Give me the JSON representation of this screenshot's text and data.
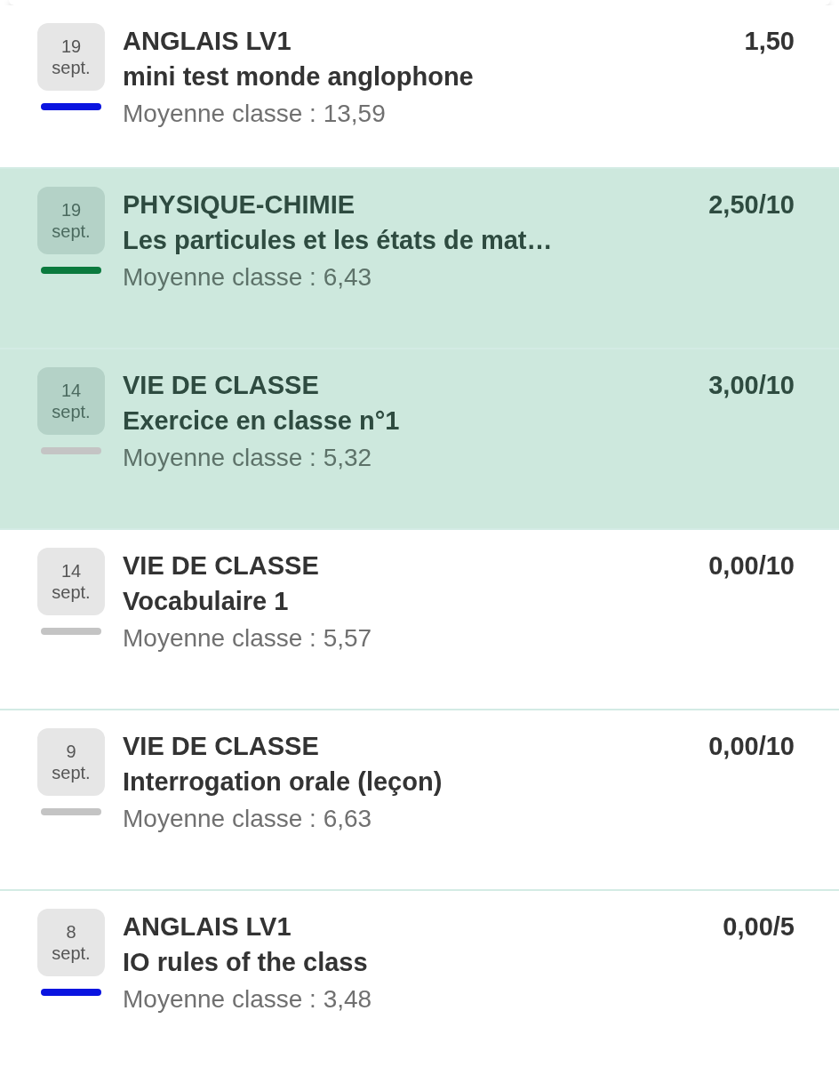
{
  "grades": [
    {
      "day": "19",
      "month": "sept.",
      "subject": "ANGLAIS LV1",
      "title": "mini test monde anglophone",
      "average": "Moyenne classe : 13,59",
      "grade": "1,50",
      "color": "#0a14e0",
      "selected": false
    },
    {
      "day": "19",
      "month": "sept.",
      "subject": "PHYSIQUE-CHIMIE",
      "title": "Les particules et les états de mat…",
      "average": "Moyenne classe : 6,43",
      "grade": "2,50/10",
      "color": "#0b7a3e",
      "selected": true
    },
    {
      "day": "14",
      "month": "sept.",
      "subject": "VIE DE CLASSE",
      "title": "Exercice en classe n°1",
      "average": "Moyenne classe : 5,32",
      "grade": "3,00/10",
      "color": "#c4c4c4",
      "selected": true
    },
    {
      "day": "14",
      "month": "sept.",
      "subject": "VIE DE CLASSE",
      "title": "Vocabulaire 1",
      "average": "Moyenne classe : 5,57",
      "grade": "0,00/10",
      "color": "#c4c4c4",
      "selected": false
    },
    {
      "day": "9",
      "month": "sept.",
      "subject": "VIE DE CLASSE",
      "title": "Interrogation orale (leçon)",
      "average": "Moyenne classe : 6,63",
      "grade": "0,00/10",
      "color": "#c4c4c4",
      "selected": false
    },
    {
      "day": "8",
      "month": "sept.",
      "subject": "ANGLAIS LV1",
      "title": "IO rules of the class",
      "average": "Moyenne classe : 3,48",
      "grade": "0,00/5",
      "color": "#0a14e0",
      "selected": false
    }
  ]
}
